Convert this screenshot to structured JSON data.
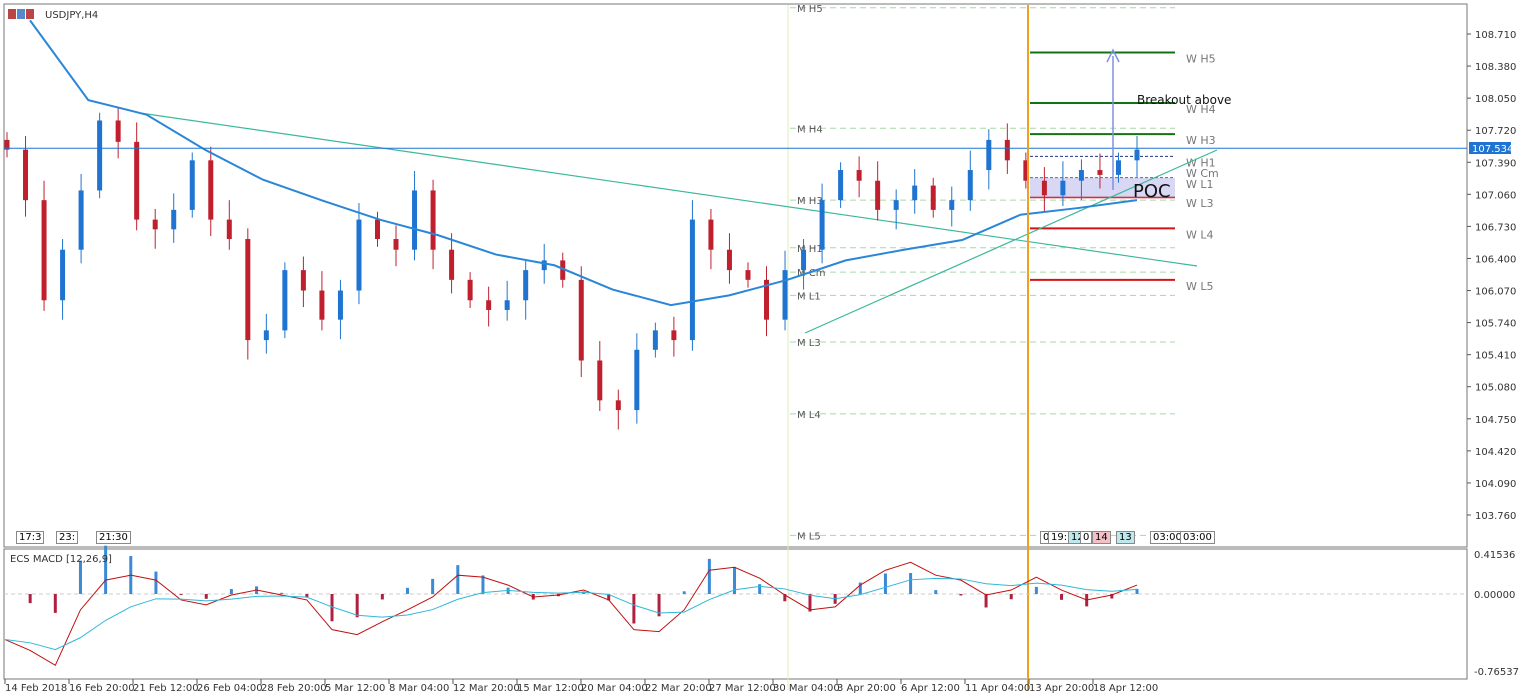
{
  "title": "USDJPY,H4",
  "current_price": "107.534",
  "annotation": "Breakout above",
  "poc_label": "POC",
  "indicator_title": "ECS MACD [12,26,9]",
  "left_tags": [
    "17:3",
    "23:",
    "21:30"
  ],
  "right_tags": [
    "0",
    "19:",
    "12",
    "0",
    "14",
    "13",
    "03:00",
    "03:00"
  ],
  "colors": {
    "bull": "#1e74d0",
    "bear": "#c0202e",
    "ma": "#2a86d8",
    "trend": "#3cb89a",
    "current": "#1e74d0",
    "orange": "#f0a020",
    "wgreen": "#137313",
    "wred": "#d41414"
  },
  "chart_data": {
    "type": "candlestick",
    "symbol": "USDJPY",
    "timeframe": "H4",
    "closes": [
      107.52,
      107.0,
      105.97,
      106.49,
      107.1,
      107.82,
      107.6,
      106.8,
      106.7,
      106.9,
      107.41,
      106.8,
      106.6,
      105.56,
      105.66,
      106.28,
      106.07,
      105.77,
      106.07,
      106.8,
      106.6,
      106.49,
      107.1,
      106.49,
      106.18,
      105.97,
      105.87,
      105.97,
      106.28,
      106.38,
      106.18,
      105.35,
      104.94,
      104.84,
      105.46,
      105.66,
      105.56,
      106.8,
      106.49,
      106.28,
      106.18,
      105.77,
      106.28,
      106.49,
      107.0,
      107.31,
      107.2,
      106.9,
      107.0,
      107.15,
      106.9,
      107.0,
      107.31,
      107.62,
      107.41,
      107.2,
      107.05,
      107.2,
      107.31,
      107.26,
      107.41,
      107.52
    ],
    "moving_average": [
      108.85,
      108.03,
      107.88,
      107.52,
      107.21,
      107.0,
      106.8,
      106.64,
      106.44,
      106.33,
      106.08,
      105.92,
      106.02,
      106.18,
      106.38,
      106.49,
      106.59,
      106.85,
      106.92,
      107.0
    ],
    "price_ticks": [
      "108.710",
      "108.380",
      "108.050",
      "107.720",
      "107.390",
      "107.060",
      "106.730",
      "106.400",
      "106.070",
      "105.740",
      "105.410",
      "105.080",
      "104.750",
      "104.420",
      "104.090",
      "103.760"
    ],
    "price_range": [
      103.76,
      108.71
    ],
    "time_ticks": [
      "14 Feb 2018",
      "16 Feb 20:00",
      "21 Feb 12:00",
      "26 Feb 04:00",
      "28 Feb 20:00",
      "5 Mar 12:00",
      "8 Mar 04:00",
      "12 Mar 20:00",
      "15 Mar 12:00",
      "20 Mar 04:00",
      "22 Mar 20:00",
      "27 Mar 12:00",
      "30 Mar 04:00",
      "3 Apr 20:00",
      "6 Apr 12:00",
      "11 Apr 04:00",
      "13 Apr 20:00",
      "18 Apr 12:00"
    ],
    "monthly_pivots": [
      {
        "label": "M  H5",
        "price": 108.98
      },
      {
        "label": "M  H4",
        "price": 107.74
      },
      {
        "label": "M  H3",
        "price": 107.0
      },
      {
        "label": "M  H1",
        "price": 106.51
      },
      {
        "label": "M  Cm",
        "price": 106.26
      },
      {
        "label": "M  L1",
        "price": 106.02
      },
      {
        "label": "M  L3",
        "price": 105.54
      },
      {
        "label": "M  L4",
        "price": 104.8
      },
      {
        "label": "M  L5",
        "price": 103.55
      }
    ],
    "weekly_pivots": [
      {
        "label": "W  H5",
        "price": 108.52,
        "style": "green"
      },
      {
        "label": "W  H4",
        "price": 108.0,
        "style": "green"
      },
      {
        "label": "W  H3",
        "price": 107.68,
        "style": "green"
      },
      {
        "label": "W  H1",
        "price": 107.45,
        "style": "dash"
      },
      {
        "label": "W  Cm",
        "price": 107.34,
        "style": "none"
      },
      {
        "label": "W  L1",
        "price": 107.23,
        "style": "dash"
      },
      {
        "label": "W  L3",
        "price": 107.03,
        "style": "red"
      },
      {
        "label": "W  L4",
        "price": 106.71,
        "style": "red"
      },
      {
        "label": "W  L5",
        "price": 106.18,
        "style": "red"
      }
    ],
    "macd": {
      "ticks": [
        "0.41536",
        "0.00000",
        "-0.76537"
      ],
      "range": [
        -0.76537,
        0.41536
      ],
      "values": [
        -0.46,
        -0.57,
        -0.72,
        -0.16,
        0.14,
        0.19,
        0.14,
        -0.06,
        -0.11,
        -0.01,
        0.04,
        -0.01,
        -0.06,
        -0.36,
        -0.41,
        -0.28,
        -0.16,
        -0.03,
        0.19,
        0.17,
        0.09,
        -0.03,
        -0.01,
        0.04,
        -0.06,
        -0.36,
        -0.38,
        -0.16,
        0.24,
        0.27,
        0.16,
        -0.01,
        -0.16,
        -0.13,
        0.09,
        0.24,
        0.32,
        0.19,
        0.14,
        -0.01,
        0.04,
        0.17,
        0.04,
        -0.06,
        -0.01,
        0.09
      ]
    }
  }
}
